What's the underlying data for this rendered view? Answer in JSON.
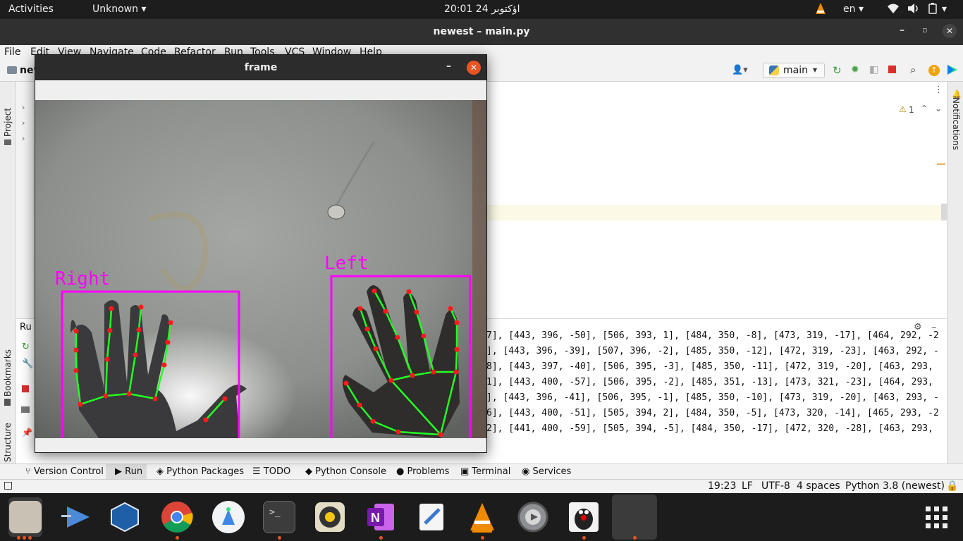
{
  "topbar": {
    "activities": "Activities",
    "app_menu": "Unknown",
    "clock": "20:01  24 اؤکتوبر",
    "language": "en"
  },
  "ide": {
    "title": "newest – main.py",
    "menu": [
      "File",
      "Edit",
      "View",
      "Navigate",
      "Code",
      "Refactor",
      "Run",
      "Tools",
      "VCS",
      "Window",
      "Help"
    ],
    "project_name_partial": "new",
    "run_config": "main",
    "left_strip": {
      "project": "Project",
      "bookmarks": "Bookmarks",
      "structure": "Structure"
    },
    "right_strip": {
      "notifications": "Notifications"
    },
    "inspection_count": "1",
    "run_label": "Ru",
    "console_lines": [
      "7], [443, 396, -50], [506, 393, 1], [484, 350, -8], [473, 319, -17], [464, 292, -2",
      "], [443, 396, -39], [507, 396, -2], [485, 350, -12], [472, 319, -23], [463, 292, -",
      "8], [443, 397, -40], [506, 395, -3], [485, 350, -11], [472, 319, -20], [463, 293,",
      "1], [443, 400, -57], [506, 395, -2], [485, 351, -13], [473, 321, -23], [464, 293,",
      "], [443, 396, -41], [506, 395, -1], [485, 350, -10], [473, 319, -20], [463, 293, -",
      "6], [443, 400, -51], [505, 394, 2], [484, 350, -5], [473, 320, -14], [465, 293, -2",
      "2], [441, 400, -59], [505, 394, -5], [484, 350, -17], [472, 320, -28], [463, 293,"
    ],
    "tool_tabs": [
      "Version Control",
      "Run",
      "Python Packages",
      "TODO",
      "Python Console",
      "Problems",
      "Terminal",
      "Services"
    ],
    "status": {
      "position": "19:23",
      "line_sep": "LF",
      "encoding": "UTF-8",
      "indent": "4 spaces",
      "interpreter": "Python 3.8 (newest)"
    }
  },
  "frame_window": {
    "title": "frame",
    "labels": {
      "right": "Right",
      "left": "Left"
    }
  },
  "colors": {
    "bbox": "#ff00ff",
    "landmark": "#ff1a1a",
    "connection": "#22ff22",
    "accent": "#e95420"
  },
  "dock": {
    "icons": [
      "files-icon",
      "vscode-like-icon",
      "virtualbox-icon",
      "chrome-icon",
      "android-studio-icon",
      "terminal-icon",
      "rhythmbox-icon",
      "onenote-icon",
      "text-editor-icon",
      "vlc-icon",
      "settings-icon",
      "java-icon",
      "active-window-icon",
      "app-grid-icon"
    ]
  }
}
